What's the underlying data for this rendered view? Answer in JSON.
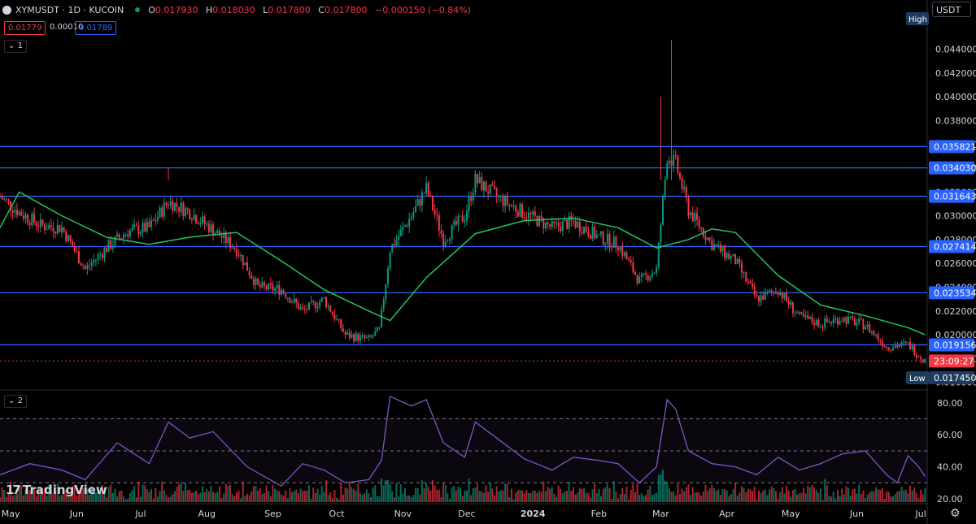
{
  "header": {
    "symbol_title": "XYMUSDT · 1D · KUCOIN",
    "ohlc": [
      {
        "k": "O",
        "v": "0.017930"
      },
      {
        "k": "H",
        "v": "0.018030"
      },
      {
        "k": "L",
        "v": "0.017800"
      },
      {
        "k": "C",
        "v": "0.017800"
      }
    ],
    "change": "−0.000150 (−0.84%)",
    "bid": "0.01779",
    "spread": "0.00010",
    "ask": "0.01789",
    "legend_toggle_1": "1",
    "legend_toggle_2": "2",
    "currency": "USDT",
    "brand": "TradingView",
    "settings_icon": "gear-icon"
  },
  "colors": {
    "background": "#000000",
    "up": "#089981",
    "down": "#f23645",
    "ma": "#22c55e",
    "hline": "#2962ff",
    "rsi": "#7e57c2",
    "text": "#d1d4dc"
  },
  "chart_data": [
    {
      "type": "candlestick",
      "title": "XYMUSDT · 1D · KUCOIN",
      "ylim": [
        0.0155,
        0.0465
      ],
      "y_ticks": [
        "0.016000",
        "0.018000",
        "0.020000",
        "0.022000",
        "0.024000",
        "0.026000",
        "0.028000",
        "0.030000",
        "0.032000",
        "0.034000",
        "0.036000",
        "0.038000",
        "0.040000",
        "0.042000",
        "0.044000"
      ],
      "x_ticks": [
        "May",
        "Jun",
        "Jul",
        "Aug",
        "Sep",
        "Oct",
        "Nov",
        "Dec",
        "2024",
        "Feb",
        "Mar",
        "Apr",
        "May",
        "Jun",
        "Jul"
      ],
      "horizontal_levels": [
        {
          "label": "0.035821",
          "value": 0.035821
        },
        {
          "label": "0.034030",
          "value": 0.03403
        },
        {
          "label": "0.031643",
          "value": 0.031643
        },
        {
          "label": "0.027414",
          "value": 0.027414
        },
        {
          "label": "0.023534",
          "value": 0.023534
        },
        {
          "label": "0.019156",
          "value": 0.019156
        }
      ],
      "last_price_countdown": "23:09:27",
      "last_price": 0.0178,
      "high_label": "High",
      "low_label": "Low",
      "low_value": "0.017450",
      "series": [
        {
          "kind": "close",
          "points": [
            [
              "2023-04-26",
              0.0316
            ],
            [
              "2023-05-05",
              0.0303
            ],
            [
              "2023-05-15",
              0.0292
            ],
            [
              "2023-05-25",
              0.029
            ],
            [
              "2023-06-05",
              0.0255
            ],
            [
              "2023-06-15",
              0.0273
            ],
            [
              "2023-06-25",
              0.0287
            ],
            [
              "2023-07-05",
              0.029
            ],
            [
              "2023-07-14",
              0.0312
            ],
            [
              "2023-07-24",
              0.0303
            ],
            [
              "2023-08-04",
              0.0288
            ],
            [
              "2023-08-15",
              0.0272
            ],
            [
              "2023-08-25",
              0.024
            ],
            [
              "2023-09-05",
              0.0238
            ],
            [
              "2023-09-15",
              0.022
            ],
            [
              "2023-09-25",
              0.023
            ],
            [
              "2023-10-05",
              0.02
            ],
            [
              "2023-10-16",
              0.0196
            ],
            [
              "2023-10-21",
              0.0204
            ],
            [
              "2023-10-26",
              0.0272
            ],
            [
              "2023-11-05",
              0.03
            ],
            [
              "2023-11-12",
              0.0323
            ],
            [
              "2023-11-20",
              0.028
            ],
            [
              "2023-11-30",
              0.03
            ],
            [
              "2023-12-05",
              0.033
            ],
            [
              "2023-12-15",
              0.0316
            ],
            [
              "2023-12-28",
              0.0302
            ],
            [
              "2024-01-10",
              0.029
            ],
            [
              "2024-01-20",
              0.0295
            ],
            [
              "2024-02-01",
              0.0282
            ],
            [
              "2024-02-10",
              0.0276
            ],
            [
              "2024-02-20",
              0.0245
            ],
            [
              "2024-02-28",
              0.0255
            ],
            [
              "2024-03-04",
              0.035
            ],
            [
              "2024-03-08",
              0.0344
            ],
            [
              "2024-03-14",
              0.0305
            ],
            [
              "2024-03-25",
              0.0276
            ],
            [
              "2024-04-05",
              0.0262
            ],
            [
              "2024-04-15",
              0.023
            ],
            [
              "2024-04-25",
              0.0238
            ],
            [
              "2024-05-05",
              0.0215
            ],
            [
              "2024-05-15",
              0.0209
            ],
            [
              "2024-05-25",
              0.0214
            ],
            [
              "2024-06-05",
              0.0208
            ],
            [
              "2024-06-15",
              0.019
            ],
            [
              "2024-06-25",
              0.0192
            ],
            [
              "2024-07-03",
              0.0178
            ]
          ]
        },
        {
          "kind": "moving_average",
          "points": [
            [
              "2023-04-26",
              0.029
            ],
            [
              "2023-05-05",
              0.032
            ],
            [
              "2023-05-25",
              0.03
            ],
            [
              "2023-06-15",
              0.0282
            ],
            [
              "2023-07-05",
              0.0276
            ],
            [
              "2023-07-24",
              0.0282
            ],
            [
              "2023-08-15",
              0.0286
            ],
            [
              "2023-09-05",
              0.0262
            ],
            [
              "2023-09-25",
              0.0238
            ],
            [
              "2023-10-16",
              0.022
            ],
            [
              "2023-10-26",
              0.0212
            ],
            [
              "2023-11-12",
              0.0248
            ],
            [
              "2023-12-05",
              0.0285
            ],
            [
              "2023-12-28",
              0.0296
            ],
            [
              "2024-01-20",
              0.0298
            ],
            [
              "2024-02-10",
              0.029
            ],
            [
              "2024-02-28",
              0.0273
            ],
            [
              "2024-03-14",
              0.028
            ],
            [
              "2024-03-25",
              0.0289
            ],
            [
              "2024-04-05",
              0.0286
            ],
            [
              "2024-04-25",
              0.025
            ],
            [
              "2024-05-15",
              0.0225
            ],
            [
              "2024-06-05",
              0.0216
            ],
            [
              "2024-06-25",
              0.0206
            ],
            [
              "2024-07-03",
              0.02
            ]
          ]
        }
      ]
    },
    {
      "type": "line",
      "title": "",
      "ylim": [
        18,
        86
      ],
      "y_ticks": [
        "20.00",
        "40.00",
        "60.00",
        "80.00"
      ],
      "series": [
        {
          "kind": "oscillator",
          "points": [
            [
              "2023-04-26",
              35
            ],
            [
              "2023-05-10",
              42
            ],
            [
              "2023-05-25",
              38
            ],
            [
              "2023-06-05",
              32
            ],
            [
              "2023-06-20",
              55
            ],
            [
              "2023-07-05",
              42
            ],
            [
              "2023-07-14",
              68
            ],
            [
              "2023-07-24",
              58
            ],
            [
              "2023-08-04",
              62
            ],
            [
              "2023-08-20",
              40
            ],
            [
              "2023-09-05",
              28
            ],
            [
              "2023-09-15",
              42
            ],
            [
              "2023-09-25",
              38
            ],
            [
              "2023-10-05",
              30
            ],
            [
              "2023-10-16",
              32
            ],
            [
              "2023-10-22",
              44
            ],
            [
              "2023-10-26",
              84
            ],
            [
              "2023-11-05",
              78
            ],
            [
              "2023-11-12",
              82
            ],
            [
              "2023-11-20",
              55
            ],
            [
              "2023-11-30",
              46
            ],
            [
              "2023-12-05",
              68
            ],
            [
              "2023-12-15",
              58
            ],
            [
              "2023-12-28",
              45
            ],
            [
              "2024-01-10",
              38
            ],
            [
              "2024-01-20",
              46
            ],
            [
              "2024-02-01",
              44
            ],
            [
              "2024-02-10",
              42
            ],
            [
              "2024-02-20",
              30
            ],
            [
              "2024-02-28",
              40
            ],
            [
              "2024-03-04",
              82
            ],
            [
              "2024-03-08",
              76
            ],
            [
              "2024-03-14",
              50
            ],
            [
              "2024-03-25",
              42
            ],
            [
              "2024-04-05",
              40
            ],
            [
              "2024-04-15",
              35
            ],
            [
              "2024-04-25",
              46
            ],
            [
              "2024-05-05",
              38
            ],
            [
              "2024-05-15",
              42
            ],
            [
              "2024-05-25",
              48
            ],
            [
              "2024-06-05",
              50
            ],
            [
              "2024-06-15",
              35
            ],
            [
              "2024-06-20",
              30
            ],
            [
              "2024-06-25",
              47
            ],
            [
              "2024-06-30",
              40
            ],
            [
              "2024-07-03",
              34
            ]
          ]
        }
      ],
      "bands": [
        30,
        50,
        70
      ]
    }
  ]
}
